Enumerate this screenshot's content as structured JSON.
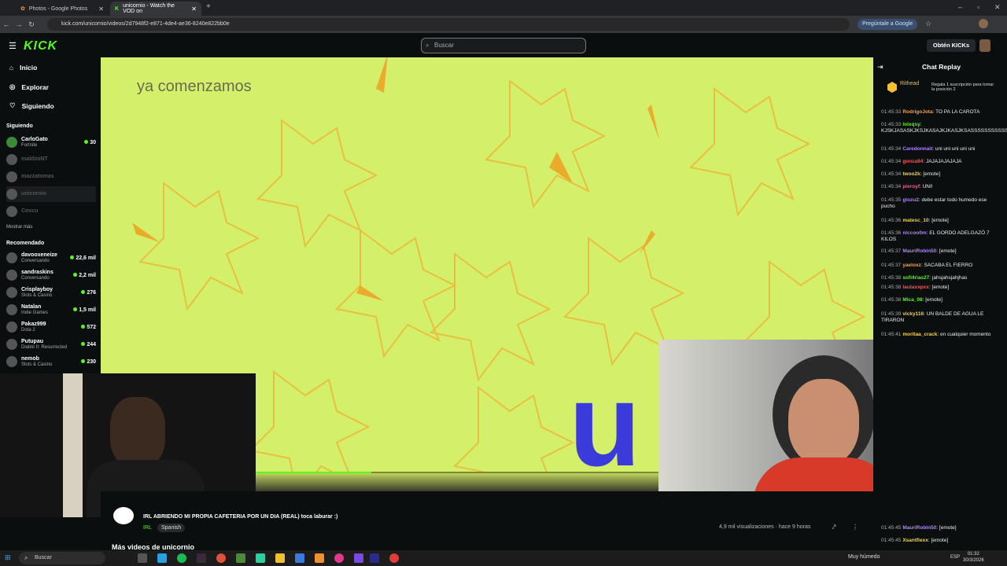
{
  "browser": {
    "tabs": [
      {
        "title": "Photos - Google Photos",
        "active": false
      },
      {
        "title": "unicornio - Watch the VOD on",
        "active": true
      }
    ],
    "url": "kick.com/unicornio/videos/2d7948f2-e871-4de4-ae36-8240e822bb0e",
    "ask_google": "Pregúntale a Google"
  },
  "header": {
    "logo": "KICK",
    "search_placeholder": "Buscar",
    "get_kicks": "Obtén KICKs"
  },
  "sidebar": {
    "nav": [
      {
        "label": "Inicio",
        "icon": "home-icon"
      },
      {
        "label": "Explorar",
        "icon": "compass-icon"
      },
      {
        "label": "Siguiendo",
        "icon": "heart-icon"
      }
    ],
    "following_title": "Siguiendo",
    "following": [
      {
        "name": "CarloGato",
        "game": "Fortnite",
        "count": "30"
      },
      {
        "name": "maldiniNT",
        "game": "",
        "count": ""
      },
      {
        "name": "mazzatomas",
        "game": "",
        "count": ""
      },
      {
        "name": "unicornio",
        "game": "",
        "count": ""
      },
      {
        "name": "Coscu",
        "game": "",
        "count": ""
      }
    ],
    "show_more": "Mostrar más",
    "recommended_title": "Recomendado",
    "recommended": [
      {
        "name": "davooxeneize",
        "game": "Conversando",
        "count": "22,6 mil"
      },
      {
        "name": "sandraskins",
        "game": "Conversando",
        "count": "2,2 mil"
      },
      {
        "name": "Crisplayboy",
        "game": "Slots & Casino",
        "count": "276"
      },
      {
        "name": "Natalan",
        "game": "Indie Games",
        "count": "1,5 mil"
      },
      {
        "name": "Pakaz999",
        "game": "Dota 2",
        "count": "572"
      },
      {
        "name": "Putupau",
        "game": "Diablo II: Resurrected",
        "count": "244"
      },
      {
        "name": "nemob",
        "game": "Slots & Casino",
        "count": "230"
      }
    ]
  },
  "video": {
    "overlay_text": "ya comenzamos",
    "big_letter": "u",
    "progress": 0.35
  },
  "stream": {
    "title": "IRL ABRIENDO MI PROPIA CAFETERIA POR UN DIA (REAL) toca laburar :)",
    "category": "IRL",
    "language": "Spanish",
    "views": "4,9 mil visualizaciones · hace 9 horas",
    "more_videos": "Más videos de unicornio"
  },
  "chat": {
    "title": "Chat Replay",
    "pinned_user": "Rithead",
    "pinned_text": "Regala 1 suscripción para tomar la posición 2",
    "messages": [
      {
        "time": "01:45:33",
        "user": "RodrigoJota",
        "color": "#f5a04a",
        "text": "TO PA LA CAROTA"
      },
      {
        "time": "01:45:33",
        "user": "lolxqsy",
        "color": "#53fc18",
        "text": "KJSKJASASKJKSJKASAJKJKASJKSASSSSSSSSSSSSSS"
      },
      {
        "time": "01:45:34",
        "user": "Caredonnait",
        "color": "#b085f5",
        "text": "uni uni uni uni uni"
      },
      {
        "time": "01:45:34",
        "user": "gonza94",
        "color": "#f05a5a",
        "text": "JAJAJAJAJAJA"
      },
      {
        "time": "01:45:34",
        "user": "twoo2k",
        "color": "#f5d04a",
        "text": "[emote]"
      },
      {
        "time": "01:45:34",
        "user": "pieroyf",
        "color": "#f05a9a",
        "text": "UNI!"
      },
      {
        "time": "01:45:35",
        "user": "giozu2",
        "color": "#b085f5",
        "text": "debe estar todo humedo ese pucho"
      },
      {
        "time": "01:45:36",
        "user": "matesc_10",
        "color": "#f5d04a",
        "text": "[emote]"
      },
      {
        "time": "01:45:36",
        "user": "niccoo0m",
        "color": "#b085f5",
        "text": "EL GORDO ADELGAZÓ 7 KILOS"
      },
      {
        "time": "01:45:37",
        "user": "MauriRobin50",
        "color": "#b085f5",
        "text": "[emote]"
      },
      {
        "time": "01:45:37",
        "user": "yaeloxz",
        "color": "#f5a04a",
        "text": "SACABA EL FIERRO"
      },
      {
        "time": "01:45:38",
        "user": "sofi4rias27",
        "color": "#53fc18",
        "text": "jahsjahsjahjhas"
      },
      {
        "time": "01:45:38",
        "user": "lautaxxpxx",
        "color": "#f05a5a",
        "text": "[emote]"
      },
      {
        "time": "01:45:38",
        "user": "Mica_08",
        "color": "#53fc18",
        "text": "[emote]"
      },
      {
        "time": "01:45:39",
        "user": "vicky116",
        "color": "#f5d04a",
        "text": "UN BALDE DE AGUA LE TIRARON"
      },
      {
        "time": "01:45:41",
        "user": "moritaa_crack",
        "color": "#f5d04a",
        "text": "en cualquier momento"
      },
      {
        "time": "01:45:45",
        "user": "MauriRobin50",
        "color": "#b085f5",
        "text": "[emote]"
      },
      {
        "time": "01:45:45",
        "user": "Xsantfiexx",
        "color": "#f5d04a",
        "text": "[emote]"
      }
    ]
  },
  "taskbar": {
    "search": "Buscar",
    "weather": "Muy húmedo",
    "lang": "ESP",
    "time": "01:32",
    "date": "30/3/2026"
  },
  "colors": {
    "brand": "#53fc18",
    "video_bg": "#d4f06a",
    "letter_blue": "#3b3bdb"
  }
}
